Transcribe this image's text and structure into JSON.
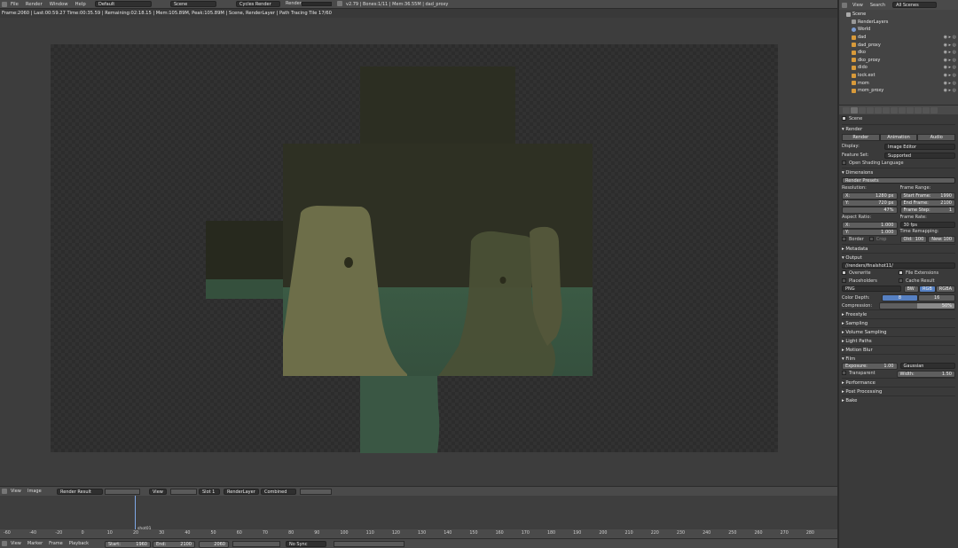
{
  "topbar": {
    "menu": [
      "File",
      "Render",
      "Window",
      "Help"
    ],
    "layout": "Default",
    "scene": "Scene",
    "engine": "Cycles Render",
    "render_tab": "Render",
    "stats": "v2.79 | Bones:1/11 | Mem:36.55M | dad_proxy"
  },
  "infobar": "Frame:2060 | Last:00:59.27 Time:00:35.59 | Remaining:02:18.15 | Mem:105.89M, Peak:105.89M | Scene, RenderLayer | Path Tracing Tile 17/60",
  "image_header": {
    "view": "View",
    "image": "Image",
    "image_name": "Render Result",
    "view2": "View",
    "slot": "Slot 1",
    "layer": "RenderLayer",
    "pass": "Combined"
  },
  "timeline": {
    "marker_label": "shot01",
    "ticks": [
      "-60",
      "-40",
      "-20",
      "0",
      "10",
      "20",
      "30",
      "40",
      "50",
      "60",
      "70",
      "80",
      "90",
      "100",
      "110",
      "120",
      "130",
      "140",
      "150",
      "160",
      "170",
      "180",
      "190",
      "200",
      "210",
      "220",
      "230",
      "240",
      "250",
      "260",
      "270",
      "280"
    ],
    "menu": [
      "View",
      "Marker",
      "Frame",
      "Playback"
    ],
    "start_label": "Start:",
    "start": "1960",
    "end_label": "End:",
    "end": "2100",
    "current": "2060",
    "sync": "No Sync"
  },
  "outliner": {
    "view": "View",
    "search": "Search",
    "scenes": "All Scenes",
    "items": [
      "Scene",
      "RenderLayers",
      "World",
      "dad",
      "dad_proxy",
      "dko",
      "dko_proxy",
      "dido",
      "lock.ext",
      "mom",
      "mom_proxy"
    ]
  },
  "properties": {
    "scene_label": "Scene",
    "render": {
      "title": "Render",
      "buttons": [
        "Render",
        "Animation",
        "Audio"
      ],
      "display_label": "Display:",
      "display_value": "Image Editor",
      "feature_label": "Feature Set:",
      "feature_value": "Supported",
      "osl": "Open Shading Language"
    },
    "dimensions": {
      "title": "Dimensions",
      "presets": "Render Presets",
      "resolution_label": "Resolution:",
      "res_x_label": "X:",
      "res_x": "1280 px",
      "res_y_label": "Y:",
      "res_y": "720 px",
      "res_pct": "47%",
      "frame_range_label": "Frame Range:",
      "start_frame_label": "Start Frame:",
      "start_frame": "1990",
      "end_frame_label": "End Frame:",
      "end_frame": "2100",
      "frame_step_label": "Frame Step:",
      "frame_step": "1",
      "aspect_label": "Aspect Ratio:",
      "asp_x_label": "X:",
      "asp_x": "1.000",
      "asp_y_label": "Y:",
      "asp_y": "1.000",
      "frame_rate_label": "Frame Rate:",
      "frame_rate": "30 fps",
      "remap_label": "Time Remapping:",
      "old_label": "Old:",
      "old": "100",
      "new_label": "New:",
      "new": "100",
      "border": "Border",
      "crop": "Crop"
    },
    "metadata": "Metadata",
    "output": {
      "title": "Output",
      "path": "//renders/finalshot11/",
      "overwrite": "Overwrite",
      "file_ext": "File Extensions",
      "placeholders": "Placeholders",
      "cache": "Cache Result",
      "format": "PNG",
      "bw": "BW",
      "rgb": "RGB",
      "rgba": "RGBA",
      "depth_label": "Color Depth:",
      "depth_8": "8",
      "depth_16": "16",
      "compression_label": "Compression:",
      "compression": "50%"
    },
    "collapsed": [
      "Freestyle",
      "Sampling",
      "Volume Sampling",
      "Light Paths",
      "Motion Blur"
    ],
    "film": {
      "title": "Film",
      "exposure_label": "Exposure:",
      "exposure": "1.00",
      "filter": "Gaussian",
      "transparent": "Transparent",
      "width_label": "Width:",
      "width": "1.50"
    },
    "tail": [
      "Performance",
      "Post Processing",
      "Bake"
    ]
  },
  "colors": {
    "accent": "#5680c2",
    "scene_dark": "#2d3022",
    "scene_floor": "#3d5a44",
    "object": "#6f704a"
  }
}
